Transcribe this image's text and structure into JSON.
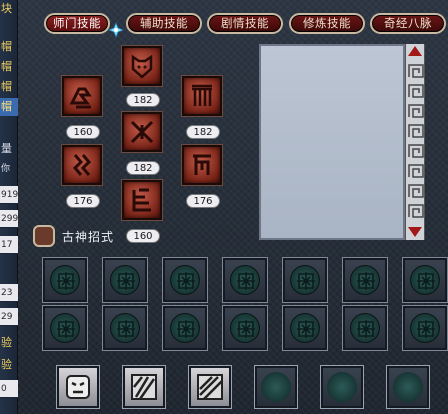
{
  "left_column": [
    "块",
    "帽",
    "帽",
    "帽",
    "帽",
    "",
    "量",
    "你",
    "919",
    "299",
    "17",
    "",
    "23",
    "29",
    "验",
    "验",
    "0"
  ],
  "tabs": [
    {
      "label": "师门技能",
      "active": true
    },
    {
      "label": "辅助技能",
      "active": false
    },
    {
      "label": "剧情技能",
      "active": false
    },
    {
      "label": "修炼技能",
      "active": false
    },
    {
      "label": "奇经八脉",
      "active": false
    }
  ],
  "skills": [
    {
      "name": "skill-1",
      "level": "160"
    },
    {
      "name": "skill-2",
      "level": "182"
    },
    {
      "name": "skill-3",
      "level": "182"
    },
    {
      "name": "skill-4",
      "level": "182"
    },
    {
      "name": "skill-5",
      "level": "176"
    },
    {
      "name": "skill-6",
      "level": "176"
    },
    {
      "name": "skill-7",
      "level": "160"
    }
  ],
  "checkbox_label": "古神招式",
  "colors": {
    "tab_bg": "#5a0c0c",
    "skill_bg": "#7a2418",
    "panel_bg": "#b4bfcd",
    "scroll_arrow": "#a21818"
  }
}
